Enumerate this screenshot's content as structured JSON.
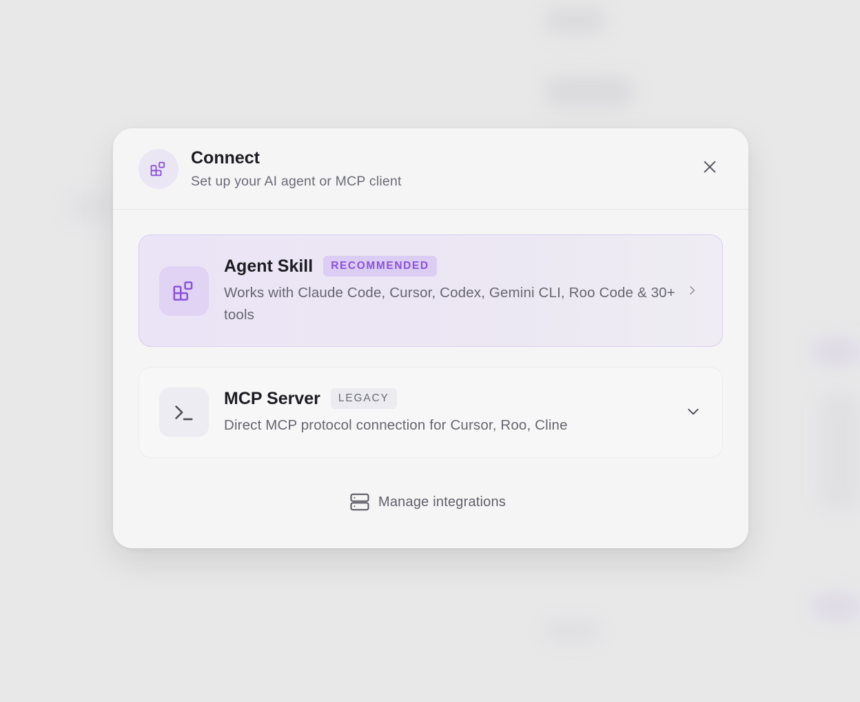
{
  "modal": {
    "title": "Connect",
    "subtitle": "Set up your AI agent or MCP client",
    "header_icon": "blocks-icon",
    "close_icon": "close-icon"
  },
  "options": [
    {
      "title": "Agent Skill",
      "badge": "RECOMMENDED",
      "description": "Works with Claude Code, Cursor, Codex, Gemini CLI, Roo Code & 30+ tools",
      "icon": "blocks-icon",
      "action_icon": "chevron-right-icon"
    },
    {
      "title": "MCP Server",
      "badge": "LEGACY",
      "description": "Direct MCP protocol connection for Cursor, Roo, Cline",
      "icon": "terminal-icon",
      "action_icon": "chevron-down-icon"
    }
  ],
  "footer": {
    "manage_label": "Manage integrations",
    "manage_icon": "server-icon"
  },
  "colors": {
    "accent": "#8a52da",
    "accent_soft": "#dccdf5",
    "text_primary": "#1c1c22",
    "text_secondary": "#66666f"
  }
}
